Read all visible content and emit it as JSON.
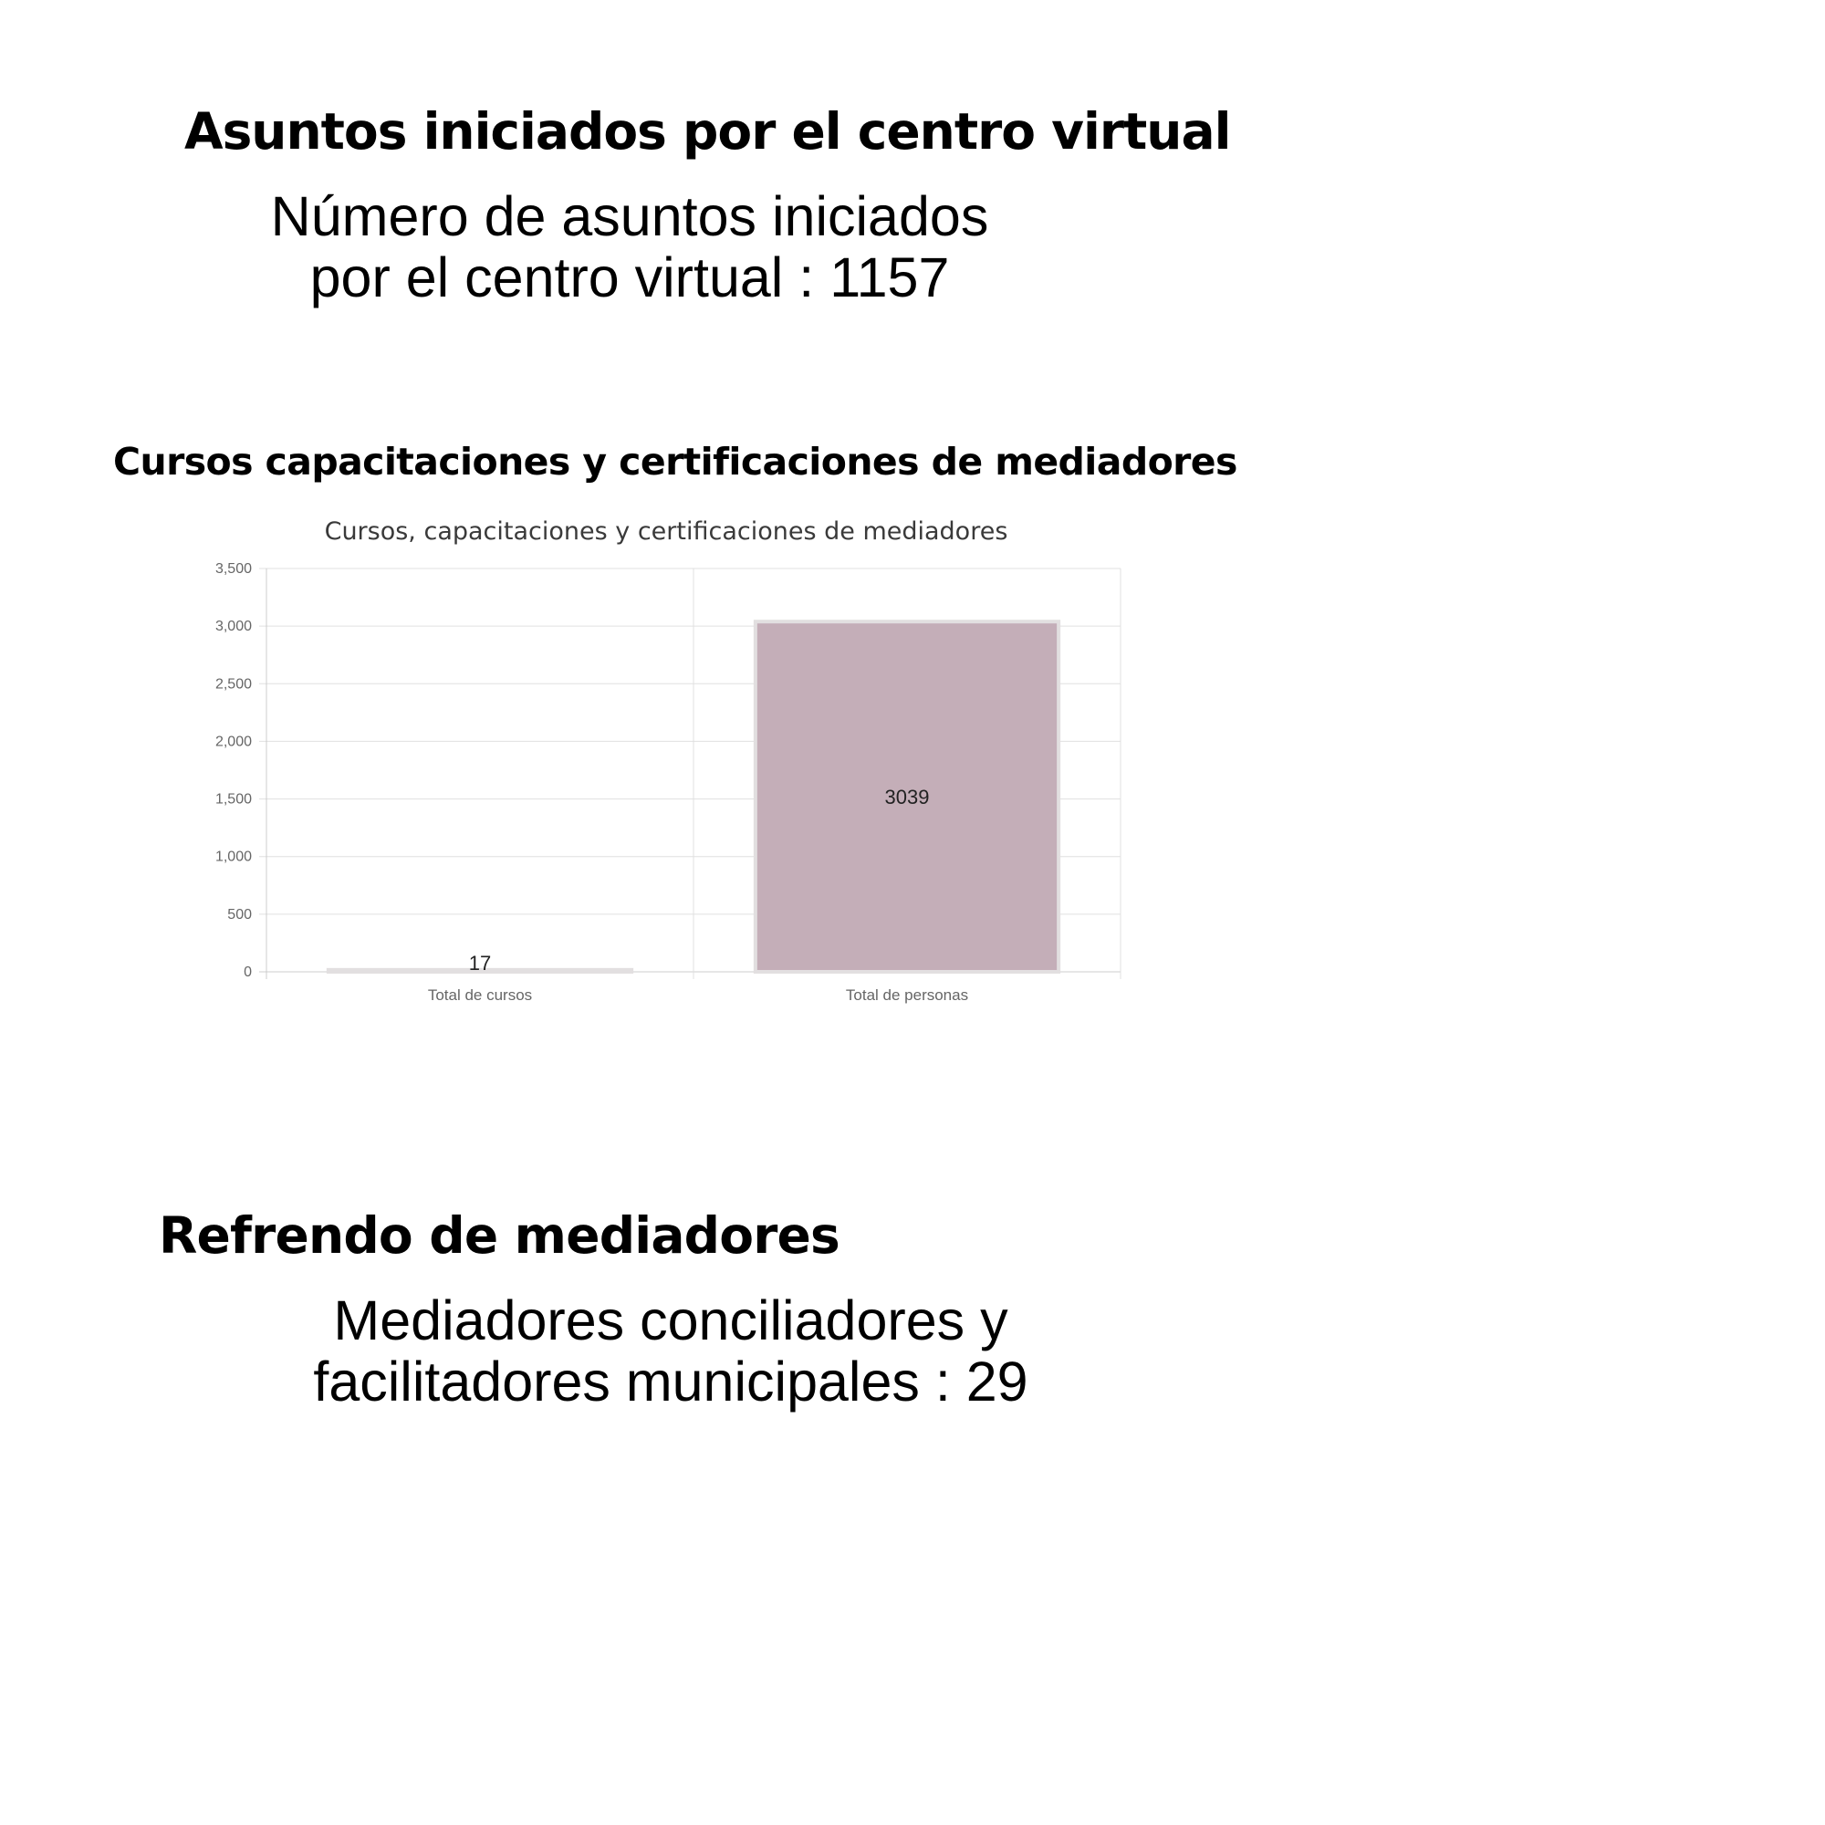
{
  "sections": {
    "asuntos": {
      "heading": "Asuntos iniciados por el centro virtual",
      "stat_line1": "Número de asuntos iniciados",
      "stat_line2": "por el centro virtual : 1157"
    },
    "cursos": {
      "heading": "Cursos capacitaciones y certificaciones de mediadores"
    },
    "refrendo": {
      "heading": "Refrendo de mediadores",
      "stat_line1": "Mediadores conciliadores y",
      "stat_line2": "facilitadores municipales : 29"
    }
  },
  "chart_data": {
    "type": "bar",
    "title": "Cursos, capacitaciones y certificaciones de mediadores",
    "categories": [
      "Total de cursos",
      "Total de personas"
    ],
    "values": [
      17,
      3039
    ],
    "data_labels": [
      "17",
      "3039"
    ],
    "ylim": [
      0,
      3500
    ],
    "yticks": [
      0,
      500,
      1000,
      1500,
      2000,
      2500,
      3000,
      3500
    ],
    "ytick_labels": [
      "0",
      "500",
      "1,000",
      "1,500",
      "2,000",
      "2,500",
      "3,000",
      "3,500"
    ],
    "xlabel": "",
    "ylabel": "",
    "grid": true,
    "legend": "none",
    "colors": {
      "bar_fill": "#c4aeb8",
      "bar_border": "#e2dfe0",
      "grid": "#e0e0e0",
      "axis": "#cccccc"
    }
  }
}
